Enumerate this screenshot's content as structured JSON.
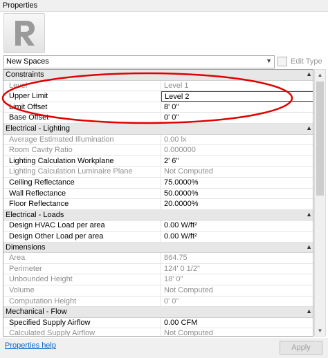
{
  "window": {
    "title": "Properties"
  },
  "type_selector": {
    "value": "New Spaces",
    "edit_type_label": "Edit Type"
  },
  "groups": [
    {
      "label": "Constraints",
      "rows": [
        {
          "name": "Level",
          "value": "Level 1",
          "disabled": true
        },
        {
          "name": "Upper Limit",
          "value": "Level 2",
          "disabled": false,
          "selected": true
        },
        {
          "name": "Limit Offset",
          "value": "8'  0\"",
          "disabled": false
        },
        {
          "name": "Base Offset",
          "value": "0'  0\"",
          "disabled": false
        }
      ]
    },
    {
      "label": "Electrical - Lighting",
      "rows": [
        {
          "name": "Average Estimated Illumination",
          "value": "0.00 lx",
          "disabled": true
        },
        {
          "name": "Room Cavity Ratio",
          "value": "0.000000",
          "disabled": true
        },
        {
          "name": "Lighting Calculation Workplane",
          "value": "2'  6\"",
          "disabled": false
        },
        {
          "name": "Lighting Calculation Luminaire Plane",
          "value": "Not Computed",
          "disabled": true
        },
        {
          "name": "Ceiling Reflectance",
          "value": "75.0000%",
          "disabled": false
        },
        {
          "name": "Wall Reflectance",
          "value": "50.0000%",
          "disabled": false
        },
        {
          "name": "Floor Reflectance",
          "value": "20.0000%",
          "disabled": false
        }
      ]
    },
    {
      "label": "Electrical - Loads",
      "rows": [
        {
          "name": "Design HVAC Load per area",
          "value": "0.00 W/ft²",
          "disabled": false
        },
        {
          "name": "Design Other Load per area",
          "value": "0.00 W/ft²",
          "disabled": false
        }
      ]
    },
    {
      "label": "Dimensions",
      "rows": [
        {
          "name": "Area",
          "value": "864.75",
          "disabled": true
        },
        {
          "name": "Perimeter",
          "value": "124'  0 1/2\"",
          "disabled": true
        },
        {
          "name": "Unbounded Height",
          "value": "18'  0\"",
          "disabled": true
        },
        {
          "name": "Volume",
          "value": "Not Computed",
          "disabled": true
        },
        {
          "name": "Computation Height",
          "value": "0'  0\"",
          "disabled": true
        }
      ]
    },
    {
      "label": "Mechanical - Flow",
      "rows": [
        {
          "name": "Specified Supply Airflow",
          "value": "0.00 CFM",
          "disabled": false
        },
        {
          "name": "Calculated Supply Airflow",
          "value": "Not Computed",
          "disabled": true
        }
      ]
    }
  ],
  "footer": {
    "help_link": "Properties help",
    "apply_label": "Apply"
  },
  "icons": {
    "logo": "revit-r-logo",
    "edit_type": "edit-type-icon",
    "group_toggle": "collapse-caret-icon",
    "dropdown": "chevron-down-icon"
  },
  "colors": {
    "annotation_ellipse": "#e00000",
    "link": "#0066cc",
    "group_header": "#e7e7e7",
    "disabled_text": "#8f8f8f"
  }
}
